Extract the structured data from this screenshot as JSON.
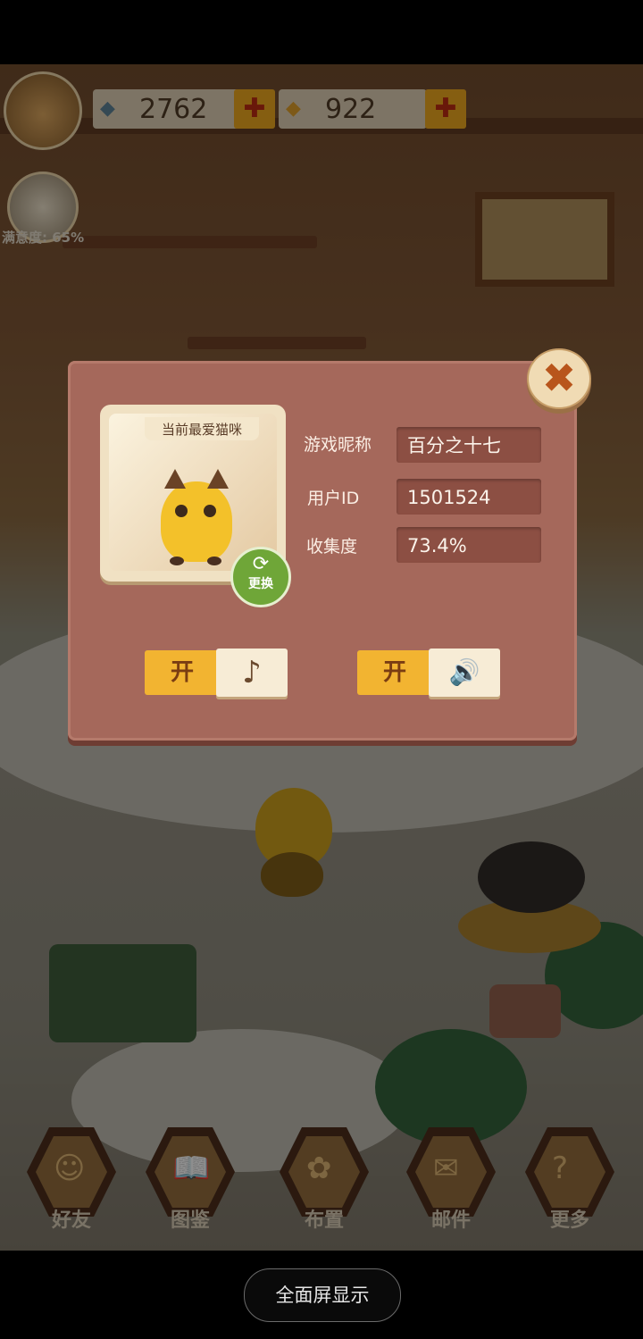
{
  "hud": {
    "fish_count": "2762",
    "coin_count": "922",
    "plus": "✚",
    "satisfaction": "满意度: 65%"
  },
  "profile_dialog": {
    "close_symbol": "✖",
    "favorite_cat_title": "当前最爱猫咪",
    "swap_label": "更换",
    "swap_icon": "⟳",
    "nickname_label": "游戏昵称",
    "nickname_value": "百分之十七",
    "user_id_label": "用户ID",
    "user_id_value": "1501524",
    "collection_label": "收集度",
    "collection_value": "73.4%",
    "music_toggle_state": "开",
    "music_icon": "♪",
    "sound_toggle_state": "开",
    "sound_icon": "🔊"
  },
  "bottom_nav": [
    {
      "label": "好友",
      "icon": "☺"
    },
    {
      "label": "图鉴",
      "icon": "📖"
    },
    {
      "label": "布置",
      "icon": "✿"
    },
    {
      "label": "邮件",
      "icon": "✉"
    },
    {
      "label": "更多",
      "icon": "?"
    }
  ],
  "system": {
    "fullscreen_label": "全面屏显示"
  }
}
